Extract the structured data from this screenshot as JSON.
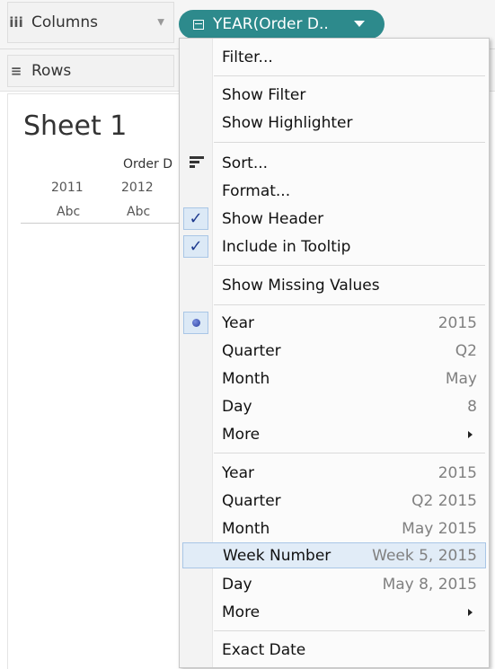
{
  "columns_shelf": {
    "icon": "iii",
    "label": "Columns"
  },
  "rows_shelf": {
    "icon": "≡",
    "label": "Rows"
  },
  "pill": {
    "label": "YEAR(Order D.."
  },
  "sheet": {
    "title": "Sheet 1",
    "header_label": "Order D",
    "years": [
      "2011",
      "2012"
    ],
    "cells": [
      "Abc",
      "Abc"
    ]
  },
  "menu": {
    "filter": "Filter...",
    "show_filter": "Show Filter",
    "show_highlighter": "Show Highlighter",
    "sort": "Sort...",
    "format": "Format...",
    "show_header": "Show Header",
    "include_tooltip": "Include in Tooltip",
    "show_missing": "Show Missing Values",
    "date_parts": [
      {
        "label": "Year",
        "value": "2015"
      },
      {
        "label": "Quarter",
        "value": "Q2"
      },
      {
        "label": "Month",
        "value": "May"
      },
      {
        "label": "Day",
        "value": "8"
      },
      {
        "label": "More",
        "value": ""
      }
    ],
    "date_values": [
      {
        "label": "Year",
        "value": "2015"
      },
      {
        "label": "Quarter",
        "value": "Q2 2015"
      },
      {
        "label": "Month",
        "value": "May 2015"
      },
      {
        "label": "Week Number",
        "value": "Week 5, 2015"
      },
      {
        "label": "Day",
        "value": "May 8, 2015"
      },
      {
        "label": "More",
        "value": ""
      }
    ],
    "exact_date": "Exact Date"
  },
  "colors": {
    "pill": "#2d8a8c",
    "highlight": "#e1ecf7",
    "check": "#1f3b8f"
  }
}
